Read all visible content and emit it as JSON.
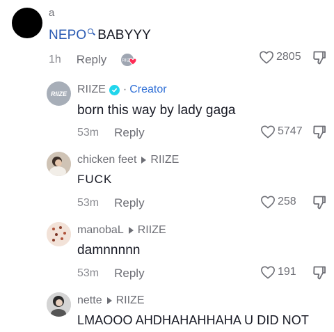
{
  "comments": [
    {
      "username": "a",
      "text_link": "NEPO",
      "text_rest": "BABYYY",
      "time": "1h",
      "reply_label": "Reply",
      "likes": "2805"
    },
    {
      "username": "RIIZE",
      "role": "Creator",
      "separator": "·",
      "avatar_text": "RIIZE",
      "text": "born this way by lady gaga",
      "time": "53m",
      "reply_label": "Reply",
      "likes": "5747"
    },
    {
      "username": "chicken feet",
      "reply_to": "RIIZE",
      "text": "FUCK",
      "time": "53m",
      "reply_label": "Reply",
      "likes": "258"
    },
    {
      "username": "manobaL",
      "reply_to": "RIIZE",
      "text": "damnnnnn",
      "time": "53m",
      "reply_label": "Reply",
      "likes": "191"
    },
    {
      "username": "nette",
      "reply_to": "RIIZE",
      "text": "LMAOOO AHDHAHAHHAHA U DID NOT"
    }
  ],
  "icons": {
    "like": "heart-outline-icon",
    "dislike": "thumbs-down-icon",
    "creator": "verified-check-icon",
    "liked_by_creator": "creator-liked-heart-icon"
  },
  "colors": {
    "text": "#161823",
    "muted": "#6d6e75",
    "link": "#2b5bb3",
    "creator": "#2f6fd6",
    "verified": "#20d5ec",
    "heart_badge": "#fe2c55"
  }
}
